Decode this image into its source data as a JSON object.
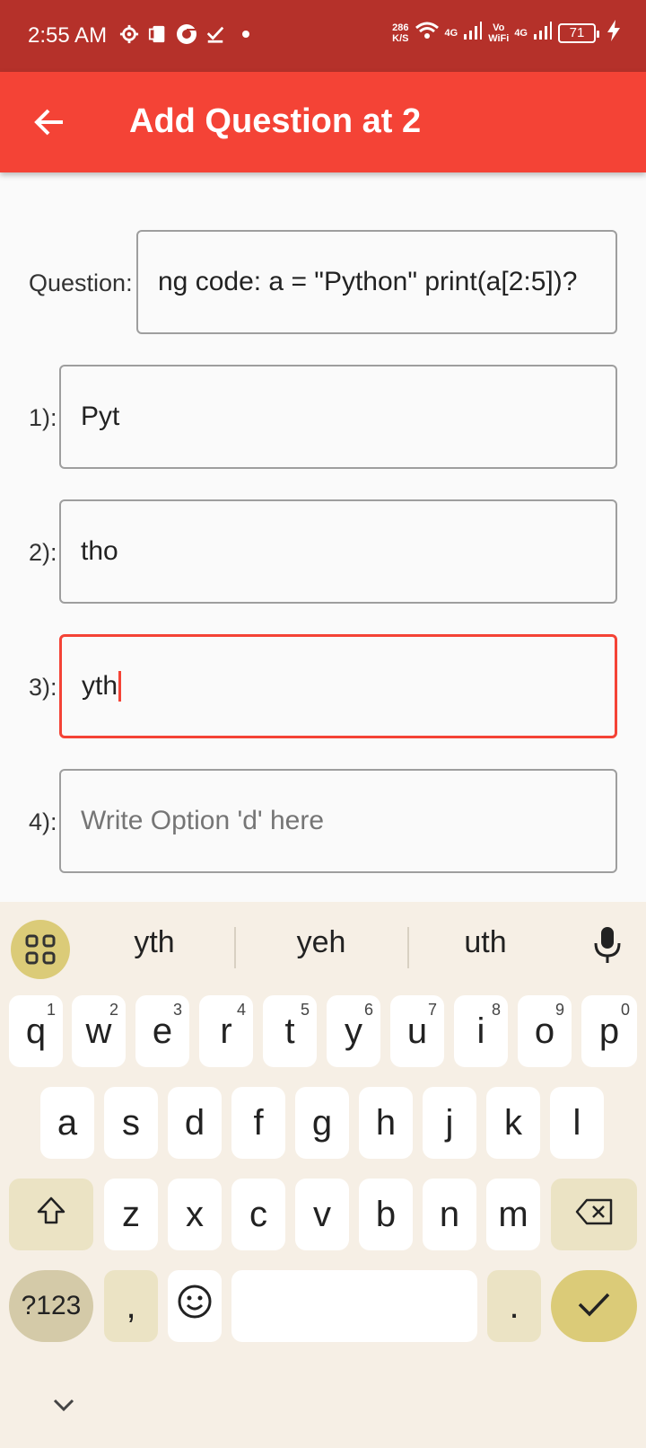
{
  "status_bar": {
    "time": "2:55 AM",
    "net_speed_value": "286",
    "net_speed_unit": "K/S",
    "signal1": "4G",
    "vowifi_top": "Vo",
    "vowifi_bottom": "WiFi",
    "signal2": "4G",
    "battery": "71",
    "icons": [
      "settings-icon",
      "sim-icon",
      "chrome-icon",
      "check-icon",
      "wifi-icon",
      "signal-icon",
      "charging-icon"
    ]
  },
  "app_bar": {
    "title": "Add Question at 2",
    "back_icon": "arrow-back-icon"
  },
  "form": {
    "question": {
      "label": "Question:",
      "value": "ng code: a = \"Python\" print(a[2:5])?"
    },
    "options": [
      {
        "label": "1):",
        "value": "Pyt",
        "placeholder": ""
      },
      {
        "label": "2):",
        "value": "tho",
        "placeholder": ""
      },
      {
        "label": "3):",
        "value": "yth",
        "placeholder": ""
      },
      {
        "label": "4):",
        "value": "",
        "placeholder": "Write Option 'd' here"
      }
    ]
  },
  "keyboard": {
    "suggestions": [
      "yth",
      "yeh",
      "uth"
    ],
    "row1": [
      "q",
      "w",
      "e",
      "r",
      "t",
      "y",
      "u",
      "i",
      "o",
      "p"
    ],
    "row1_hints": [
      "1",
      "2",
      "3",
      "4",
      "5",
      "6",
      "7",
      "8",
      "9",
      "0"
    ],
    "row2": [
      "a",
      "s",
      "d",
      "f",
      "g",
      "h",
      "j",
      "k",
      "l"
    ],
    "row3": [
      "z",
      "x",
      "c",
      "v",
      "b",
      "n",
      "m"
    ],
    "symbols_key": "?123",
    "comma_key": ",",
    "period_key": ".",
    "accent_color": "#dbcb78"
  },
  "colors": {
    "status_bar": "#b5312a",
    "app_bar": "#f44336",
    "focus": "#f44336"
  }
}
